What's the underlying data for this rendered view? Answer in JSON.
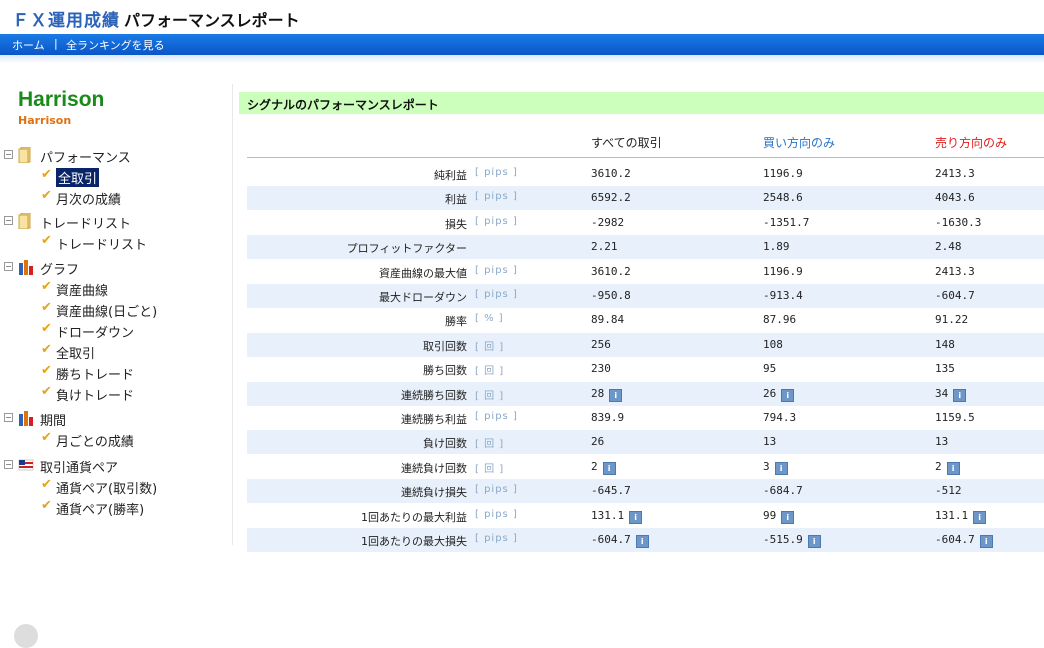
{
  "header": {
    "title": "ＦＸ運用成績",
    "subtitle": "パフォーマンスレポート"
  },
  "nav": {
    "home": "ホーム",
    "sep": "|",
    "rankings": "全ランキングを見る"
  },
  "sidebar": {
    "signal_name": "Harrison",
    "signal_sub": "Harrison",
    "groups": [
      {
        "label": "パフォーマンス",
        "icon": "folder-icon",
        "items": [
          "全取引",
          "月次の成績"
        ]
      },
      {
        "label": "トレードリスト",
        "icon": "folder-icon",
        "items": [
          "トレードリスト"
        ]
      },
      {
        "label": "グラフ",
        "icon": "bar-chart-icon",
        "items": [
          "資産曲線",
          "資産曲線(日ごと)",
          "ドローダウン",
          "全取引",
          "勝ちトレード",
          "負けトレード"
        ]
      },
      {
        "label": "期間",
        "icon": "bar-chart-icon",
        "items": [
          "月ごとの成績"
        ]
      },
      {
        "label": "取引通貨ペア",
        "icon": "flag-icon",
        "items": [
          "通貨ペア(取引数)",
          "通貨ペア(勝率)"
        ]
      }
    ]
  },
  "report": {
    "title": "シグナルのパフォーマンスレポート",
    "col_all": "すべての取引",
    "col_buy": "買い方向のみ",
    "col_sell": "売り方向のみ",
    "colors": {
      "buy": "#2a74c8",
      "sell": "#e02020"
    },
    "rows": [
      {
        "label": "純利益",
        "unit": "[ pips ]",
        "all": "3610.2",
        "buy": "1196.9",
        "sell": "2413.3"
      },
      {
        "label": "利益",
        "unit": "[ pips ]",
        "all": "6592.2",
        "buy": "2548.6",
        "sell": "4043.6"
      },
      {
        "label": "損失",
        "unit": "[ pips ]",
        "all": "-2982",
        "buy": "-1351.7",
        "sell": "-1630.3"
      },
      {
        "label": "プロフィットファクター",
        "unit": "",
        "all": "2.21",
        "buy": "1.89",
        "sell": "2.48"
      },
      {
        "label": "資産曲線の最大値",
        "unit": "[ pips ]",
        "all": "3610.2",
        "buy": "1196.9",
        "sell": "2413.3"
      },
      {
        "label": "最大ドローダウン",
        "unit": "[ pips ]",
        "all": "-950.8",
        "buy": "-913.4",
        "sell": "-604.7"
      },
      {
        "label": "勝率",
        "unit": "[ % ]",
        "all": "89.84",
        "buy": "87.96",
        "sell": "91.22"
      },
      {
        "label": "取引回数",
        "unit": "[ 回 ]",
        "all": "256",
        "buy": "108",
        "sell": "148"
      },
      {
        "label": "勝ち回数",
        "unit": "[ 回 ]",
        "all": "230",
        "buy": "95",
        "sell": "135"
      },
      {
        "label": "連続勝ち回数",
        "unit": "[ 回 ]",
        "all": "28",
        "buy": "26",
        "sell": "34",
        "info": true
      },
      {
        "label": "連続勝ち利益",
        "unit": "[ pips ]",
        "all": "839.9",
        "buy": "794.3",
        "sell": "1159.5"
      },
      {
        "label": "負け回数",
        "unit": "[ 回 ]",
        "all": "26",
        "buy": "13",
        "sell": "13"
      },
      {
        "label": "連続負け回数",
        "unit": "[ 回 ]",
        "all": "2",
        "buy": "3",
        "sell": "2",
        "info": true
      },
      {
        "label": "連続負け損失",
        "unit": "[ pips ]",
        "all": "-645.7",
        "buy": "-684.7",
        "sell": "-512"
      },
      {
        "label": "1回あたりの最大利益",
        "unit": "[ pips ]",
        "all": "131.1",
        "buy": "99",
        "sell": "131.1",
        "info": true
      },
      {
        "label": "1回あたりの最大損失",
        "unit": "[ pips ]",
        "all": "-604.7",
        "buy": "-515.9",
        "sell": "-604.7",
        "info": true
      }
    ]
  }
}
